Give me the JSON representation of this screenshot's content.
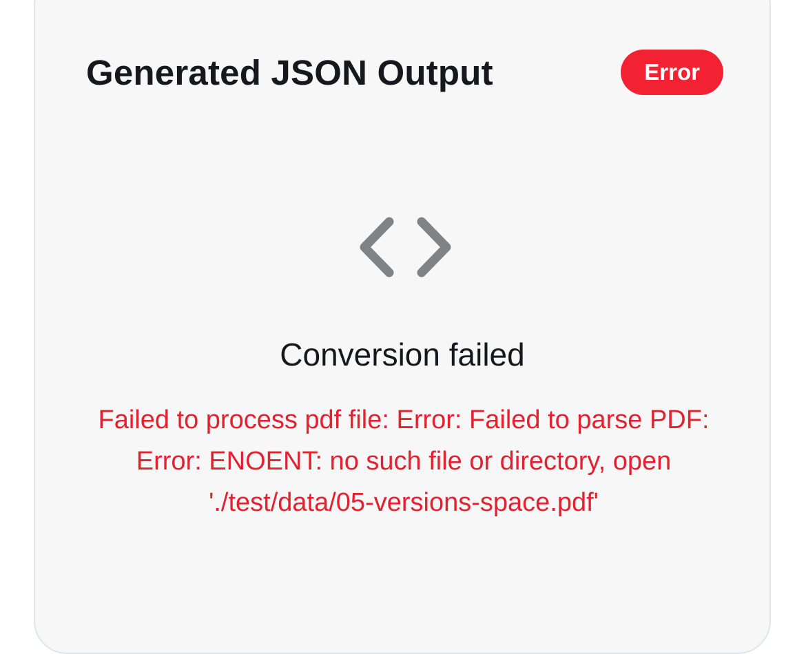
{
  "card": {
    "title": "Generated JSON Output",
    "status_badge": "Error"
  },
  "empty_state": {
    "icon": "code-brackets-icon",
    "heading": "Conversion failed",
    "error_message": "Failed to process pdf file: Error: Failed to parse PDF: Error: ENOENT: no such file or directory, open './test/data/05-versions-space.pdf'"
  },
  "colors": {
    "error": "#f22233",
    "error_text": "#e2222f",
    "icon": "#808284",
    "card_background": "#f7f7f8",
    "card_border": "#dfe5ec"
  }
}
